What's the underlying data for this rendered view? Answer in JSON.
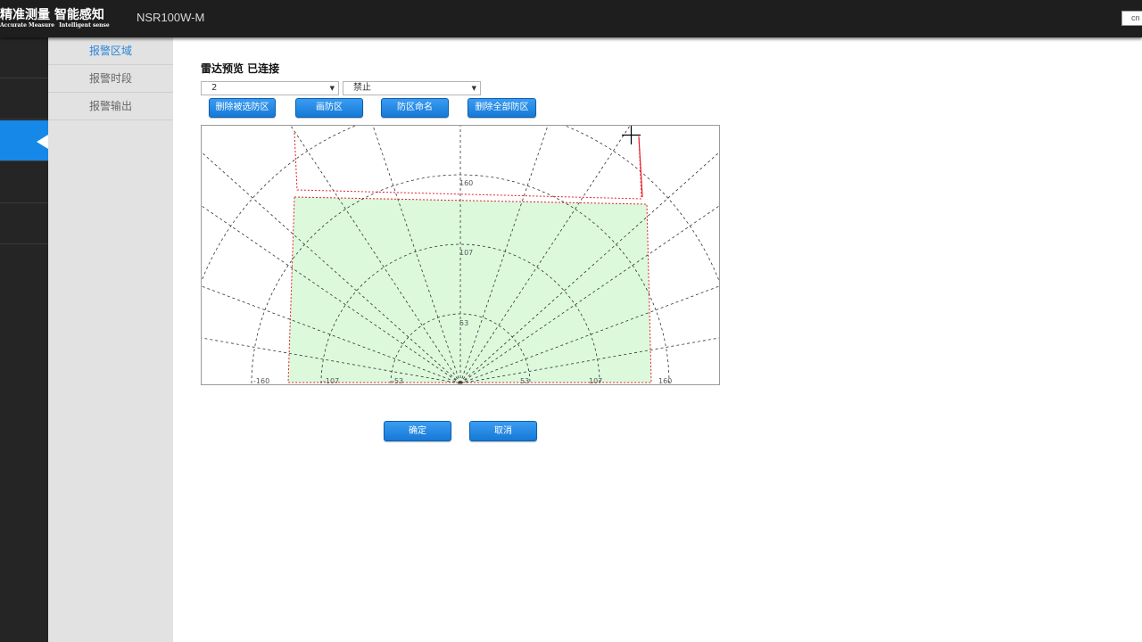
{
  "header": {
    "logo_cn": "精准测量 智能感知",
    "logo_en_1": "Accurate Measure",
    "logo_en_2": "Intelligent sense",
    "model": "NSR100W-M",
    "lang": "cn"
  },
  "submenu": {
    "items": [
      {
        "label": "报警区域"
      },
      {
        "label": "报警时段"
      },
      {
        "label": "报警输出"
      }
    ]
  },
  "main": {
    "title": "雷达预览 已连接",
    "zone_select": {
      "value": "2"
    },
    "mode_select": {
      "value": "禁止"
    },
    "buttons": {
      "delete_selected": "删除被选防区",
      "draw_zone": "画防区",
      "name_zone": "防区命名",
      "delete_all": "删除全部防区"
    },
    "confirm": "确定",
    "cancel": "取消"
  },
  "radar": {
    "range_labels": {
      "r1": "53",
      "r2": "107",
      "r3": "160",
      "left_1": "-53",
      "left_2": "-107",
      "left_3": "-160",
      "right_1": "53",
      "right_2": "107",
      "right_3": "160",
      "origin": "0"
    },
    "colors": {
      "zone_fill": "#dcf9dc",
      "zone_border": "#e8202a",
      "grid": "#333333"
    }
  }
}
